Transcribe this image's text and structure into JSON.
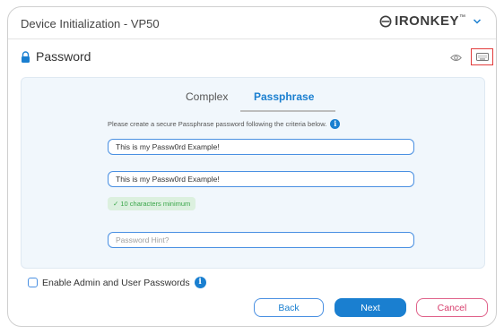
{
  "window": {
    "title": "Device Initialization - VP50",
    "brand": "IRONKEY",
    "brand_tm": "™"
  },
  "section": {
    "title": "Password"
  },
  "tabs": [
    {
      "label": "Complex",
      "active": false
    },
    {
      "label": "Passphrase",
      "active": true
    }
  ],
  "instructions": "Please create a secure Passphrase password following the criteria below.",
  "fields": {
    "password": "This is my Passw0rd Example!",
    "confirm": "This is my Passw0rd Example!",
    "hint_placeholder": "Password Hint?"
  },
  "criteria": [
    "✓ 10 characters minimum"
  ],
  "checkbox": {
    "label": "Enable Admin and User Passwords",
    "checked": false
  },
  "buttons": {
    "back": "Back",
    "next": "Next",
    "cancel": "Cancel"
  },
  "icons": {
    "info": "i"
  },
  "colors": {
    "accent": "#1a7fd0",
    "panel_bg": "#f1f7fc",
    "success": "#3aa64a",
    "cancel": "#d73d6c",
    "highlight": "#e23b3b"
  }
}
